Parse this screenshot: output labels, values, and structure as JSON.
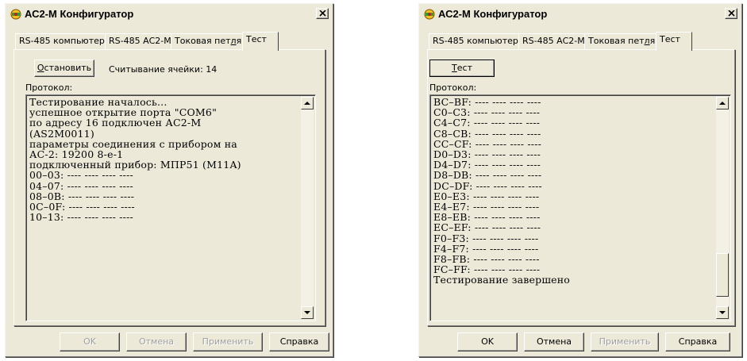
{
  "windows": [
    {
      "title": "АС2-М Конфигуратор",
      "tabs": [
        {
          "label": "RS-485 компьютера"
        },
        {
          "label": "RS-485 АС2-М"
        },
        {
          "label": "Токовая петля",
          "accel_pre": "Токовая пет",
          "accel": "л",
          "accel_post": "я"
        },
        {
          "label": "Тест",
          "active": true
        }
      ],
      "action_button": {
        "accel": "О",
        "rest": "становить"
      },
      "status_text": "Считывание ячейки: 14",
      "protocol_label": "Протокол:",
      "log_lines": [
        "Тестирование началось...",
        "успешное открытие порта \"COM6\"",
        "по адресу 16 подключен АС2-М",
        "(AS2M0011)",
        "параметры соединения с прибором на",
        "АС-2: 19200 8-е-1",
        "подключенный прибор: МПР51 (M11A)",
        "00–03: ---- ---- ---- ----",
        "04–07: ---- ---- ---- ----",
        "08–0B: ---- ---- ---- ----",
        "0C–0F: ---- ---- ---- ----",
        "10–13: ---- ---- ---- ----"
      ],
      "footer": {
        "ok": "OK",
        "cancel": "Отмена",
        "apply": "Применить",
        "help": "Справка"
      },
      "footer_state": "disabled"
    },
    {
      "title": "АС2-М Конфигуратор",
      "tabs": [
        {
          "label": "RS-485 компьютера"
        },
        {
          "label": "RS-485 АС2-М"
        },
        {
          "label": "Токовая петля",
          "accel_pre": "Токовая пет",
          "accel": "л",
          "accel_post": "я"
        },
        {
          "label": "Тест",
          "active": true
        }
      ],
      "action_button": {
        "accel": "Т",
        "rest": "ест"
      },
      "protocol_label": "Протокол:",
      "log_lines": [
        "BC–BF: ---- ---- ---- ----",
        "C0–C3: ---- ---- ---- ----",
        "C4–C7: ---- ---- ---- ----",
        "C8–CB: ---- ---- ---- ----",
        "CC–CF: ---- ---- ---- ----",
        "D0–D3: ---- ---- ---- ----",
        "D4–D7: ---- ---- ---- ----",
        "D8–DB: ---- ---- ---- ----",
        "DC–DF: ---- ---- ---- ----",
        "E0–E3: ---- ---- ---- ----",
        "E4–E7: ---- ---- ---- ----",
        "E8–EB: ---- ---- ---- ----",
        "EC–EF: ---- ---- ---- ----",
        "F0–F3: ---- ---- ---- ----",
        "F4–F7: ---- ---- ---- ----",
        "F8–FB: ---- ---- ---- ----",
        "FC–FF: ---- ---- ---- ----",
        "Тестирование завершено"
      ],
      "footer": {
        "ok": "OK",
        "cancel": "Отмена",
        "apply": "Применить",
        "help": "Справка"
      },
      "footer_state": "enabled-except-apply"
    }
  ],
  "icons": {
    "app": "app-icon",
    "close": "close-icon",
    "scroll_up": "scroll-up-arrow-icon",
    "scroll_down": "scroll-down-arrow-icon"
  }
}
